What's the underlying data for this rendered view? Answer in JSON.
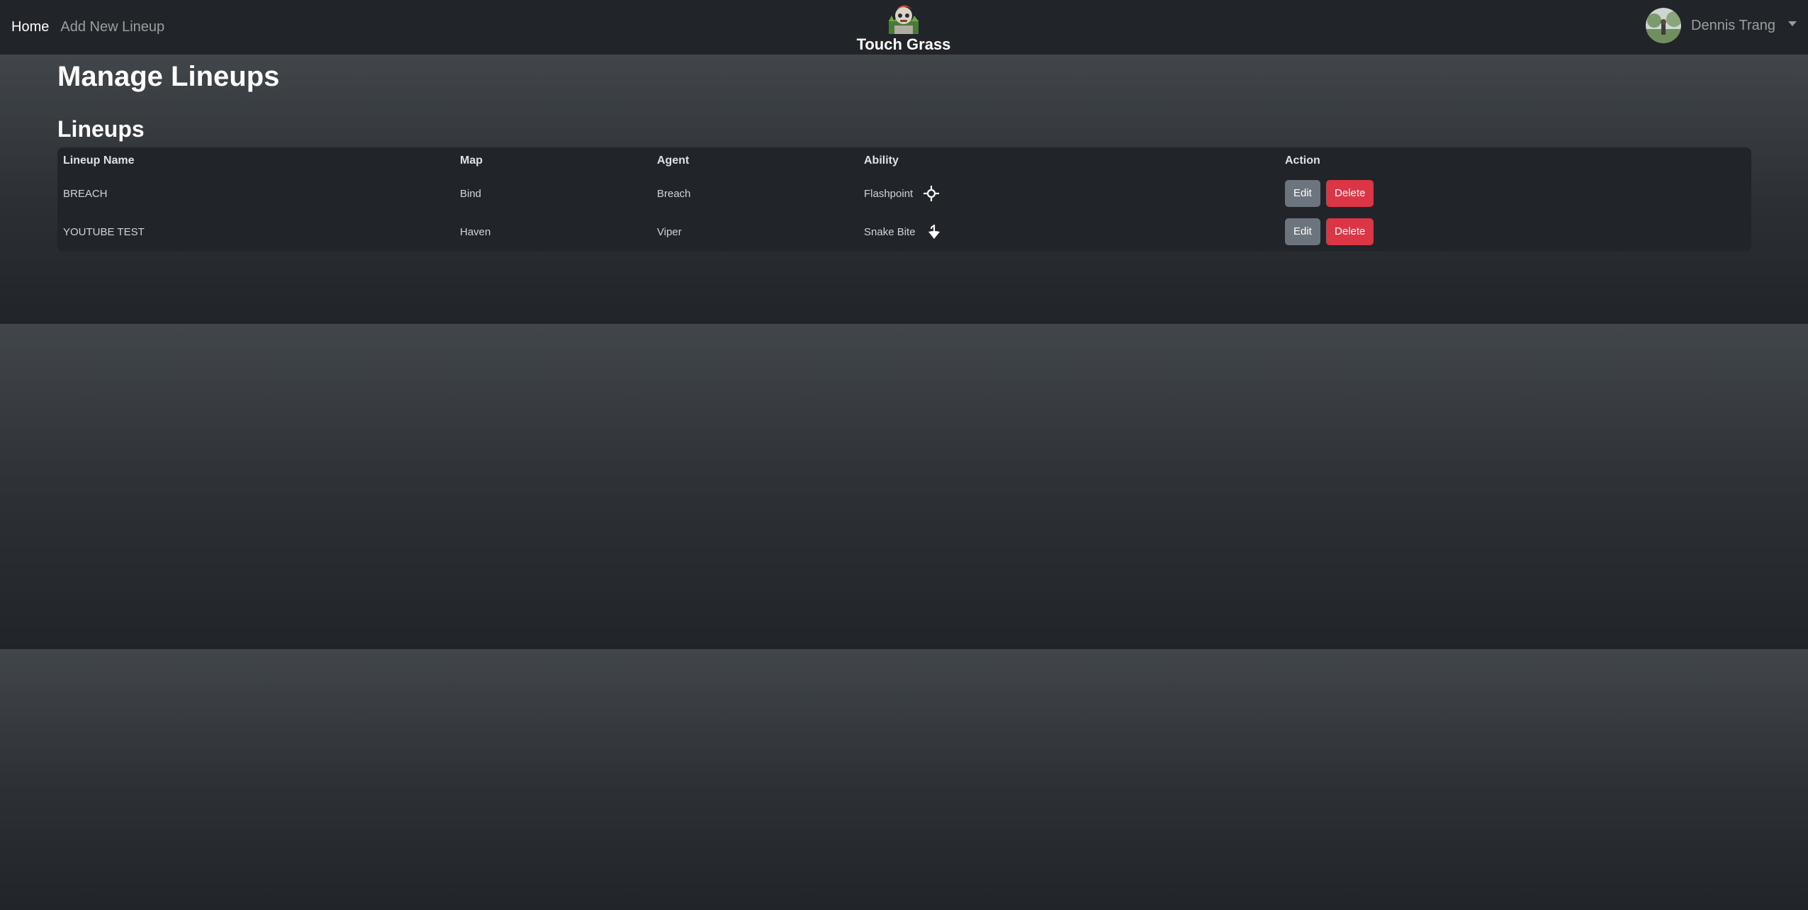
{
  "nav": {
    "links": [
      {
        "label": "Home",
        "active": true
      },
      {
        "label": "Add New Lineup",
        "active": false
      }
    ],
    "brand": "Touch Grass",
    "brand_logo": "grass-mascot-logo",
    "user": {
      "name": "Dennis Trang",
      "avatar": "avatar-image",
      "dropdown_icon": "caret-down-icon"
    }
  },
  "page": {
    "title": "Manage Lineups",
    "section_title": "Lineups"
  },
  "table": {
    "headers": [
      "Lineup Name",
      "Map",
      "Agent",
      "Ability",
      "Action"
    ],
    "rows": [
      {
        "name": "BREACH",
        "map": "Bind",
        "agent": "Breach",
        "ability": "Flashpoint",
        "ability_icon": "flashpoint-icon",
        "edit": "Edit",
        "delete": "Delete"
      },
      {
        "name": "YOUTUBE TEST",
        "map": "Haven",
        "agent": "Viper",
        "ability": "Snake Bite",
        "ability_icon": "snake-bite-icon",
        "edit": "Edit",
        "delete": "Delete"
      }
    ]
  },
  "colors": {
    "navbar": "#212529",
    "edit_button": "#6c757d",
    "delete_button": "#dc3545"
  }
}
